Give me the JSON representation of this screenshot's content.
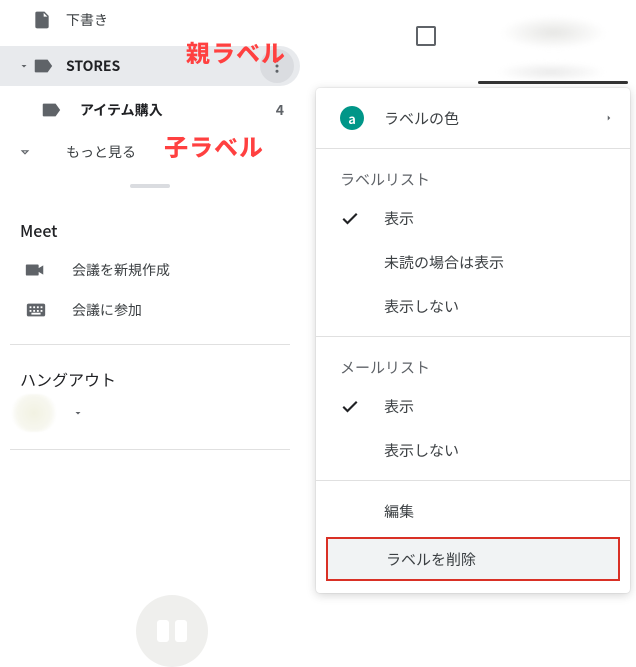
{
  "sidebar": {
    "drafts": "下書き",
    "stores": "STORES",
    "child_label": "アイテム購入",
    "child_count": "4",
    "more": "もっと見る"
  },
  "meet": {
    "title": "Meet",
    "new": "会議を新規作成",
    "join": "会議に参加"
  },
  "hangout": {
    "title": "ハングアウト"
  },
  "annotations": {
    "parent": "親ラベル",
    "child": "子ラベル"
  },
  "menu": {
    "color_badge": "a",
    "label_color": "ラベルの色",
    "list_heading": "ラベルリスト",
    "show": "表示",
    "show_if_unread": "未読の場合は表示",
    "hide": "表示しない",
    "mail_heading": "メールリスト",
    "m_show": "表示",
    "m_hide": "表示しない",
    "edit": "編集",
    "delete": "ラベルを削除"
  }
}
